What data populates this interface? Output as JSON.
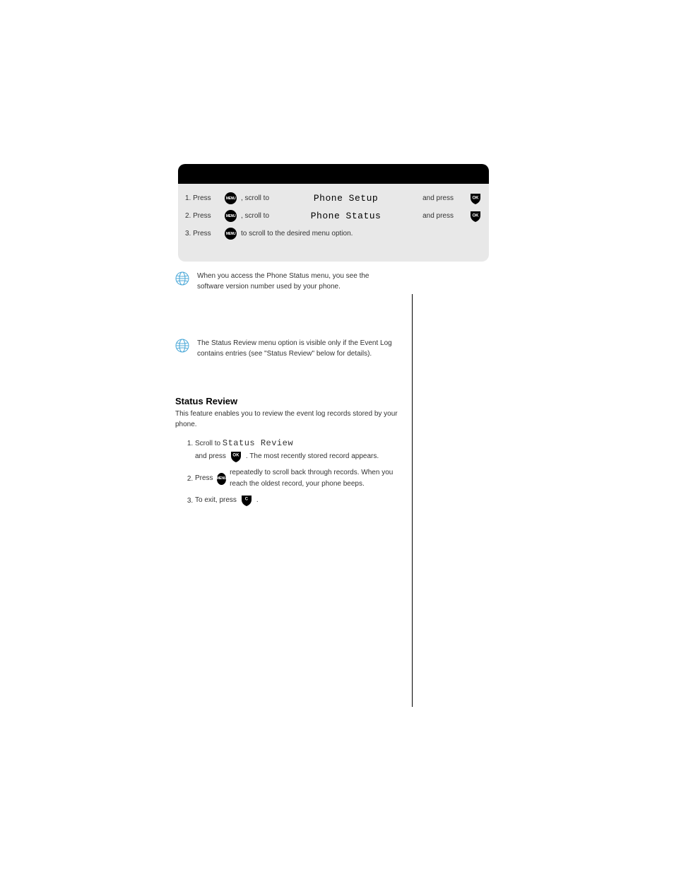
{
  "nav": {
    "step1": "1. Press",
    "step2": "2. Press",
    "step3": "3. Press",
    "label1": "Phone Setup",
    "label2": "Phone Status",
    "scrollTo1": ", scroll to",
    "scrollTo2": ", scroll to",
    "pressEnd": "and press",
    "desired": "to scroll to the desired menu option."
  },
  "globe1": {
    "text": "When you access the Phone Status menu, you see the software version number used by your phone."
  },
  "globe2": {
    "text": "The Status Review menu option is visible only if the Event Log contains entries (see \"Status Review\" below for details)."
  },
  "section": {
    "heading": "Status Review",
    "intro": "This feature enables you to review the event log records stored by your phone.",
    "reviewLabel": "Status Review",
    "step1a": "Scroll to",
    "step1b": "and press",
    "step1c": ". The most recently stored record appears.",
    "step2a": "Press",
    "step2b": "repeatedly to scroll back through records. When you reach the oldest record, your phone beeps.",
    "step3a": "To exit, press",
    "step3b": "."
  },
  "icons": {
    "menu": "MENU",
    "ok": "OK",
    "c": "C"
  }
}
